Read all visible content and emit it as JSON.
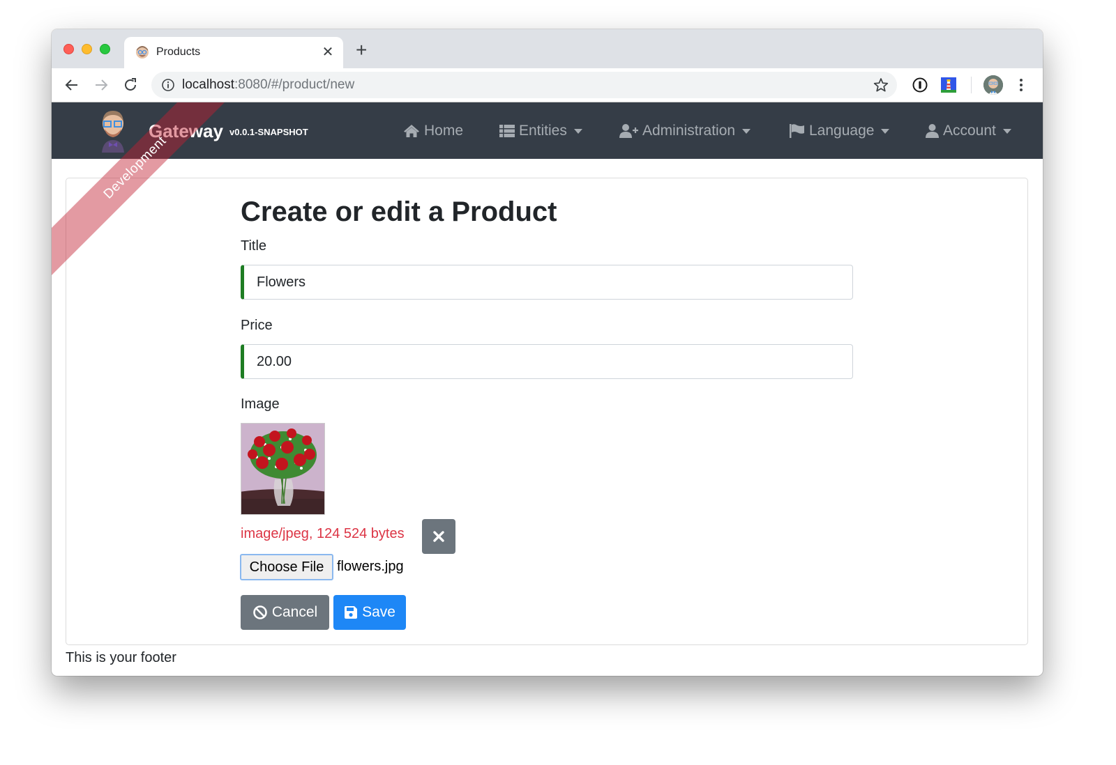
{
  "browser": {
    "tab": {
      "title": "Products",
      "favicon": "avatar-favicon-icon"
    },
    "address": {
      "host": "localhost",
      "rest": ":8080/#/product/new"
    },
    "icons": [
      "back-arrow-icon",
      "forward-arrow-icon",
      "reload-icon",
      "info-icon",
      "star-icon",
      "1password-icon",
      "lighthouse-icon",
      "profile-avatar",
      "kebab-menu-icon"
    ]
  },
  "navbar": {
    "brand": "Gateway",
    "version": "v0.0.1-SNAPSHOT",
    "ribbon": "Development",
    "items": [
      {
        "label": "Home",
        "icon": "home-icon",
        "dropdown": false
      },
      {
        "label": "Entities",
        "icon": "list-icon",
        "dropdown": true
      },
      {
        "label": "Administration",
        "icon": "user-plus-icon",
        "dropdown": true
      },
      {
        "label": "Language",
        "icon": "flag-icon",
        "dropdown": true
      },
      {
        "label": "Account",
        "icon": "user-icon",
        "dropdown": true
      }
    ]
  },
  "form": {
    "heading": "Create or edit a Product",
    "title": {
      "label": "Title",
      "value": "Flowers"
    },
    "price": {
      "label": "Price",
      "value": "20.00"
    },
    "image": {
      "label": "Image",
      "meta": "image/jpeg, 124 524 bytes",
      "choose_label": "Choose File",
      "file_name": "flowers.jpg"
    },
    "cancel_label": "Cancel",
    "save_label": "Save"
  },
  "footer": {
    "text": "This is your footer"
  },
  "colors": {
    "navbar": "#353d47",
    "primary": "#1e87f6",
    "secondary": "#6c757d",
    "valid": "#1e7d23",
    "danger": "#dc3545"
  }
}
